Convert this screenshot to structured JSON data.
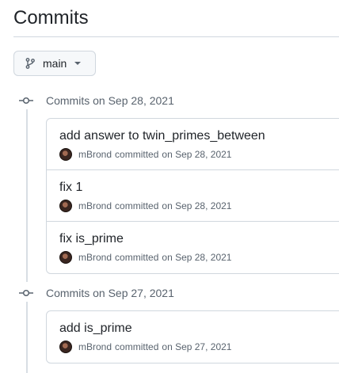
{
  "page": {
    "title": "Commits"
  },
  "branch": {
    "name": "main"
  },
  "groups": [
    {
      "title": "Commits on Sep 28, 2021",
      "commits": [
        {
          "message": "add answer to twin_primes_between",
          "author": "mBrond",
          "verb": "committed",
          "date": "on Sep 28, 2021"
        },
        {
          "message": "fix 1",
          "author": "mBrond",
          "verb": "committed",
          "date": "on Sep 28, 2021"
        },
        {
          "message": "fix is_prime",
          "author": "mBrond",
          "verb": "committed",
          "date": "on Sep 28, 2021"
        }
      ]
    },
    {
      "title": "Commits on Sep 27, 2021",
      "commits": [
        {
          "message": "add is_prime",
          "author": "mBrond",
          "verb": "committed",
          "date": "on Sep 27, 2021"
        }
      ]
    }
  ],
  "colors": {
    "border": "#d0d7de",
    "muted_text": "#59636e",
    "text": "#1f2328",
    "button_bg": "#f6f8fa"
  }
}
